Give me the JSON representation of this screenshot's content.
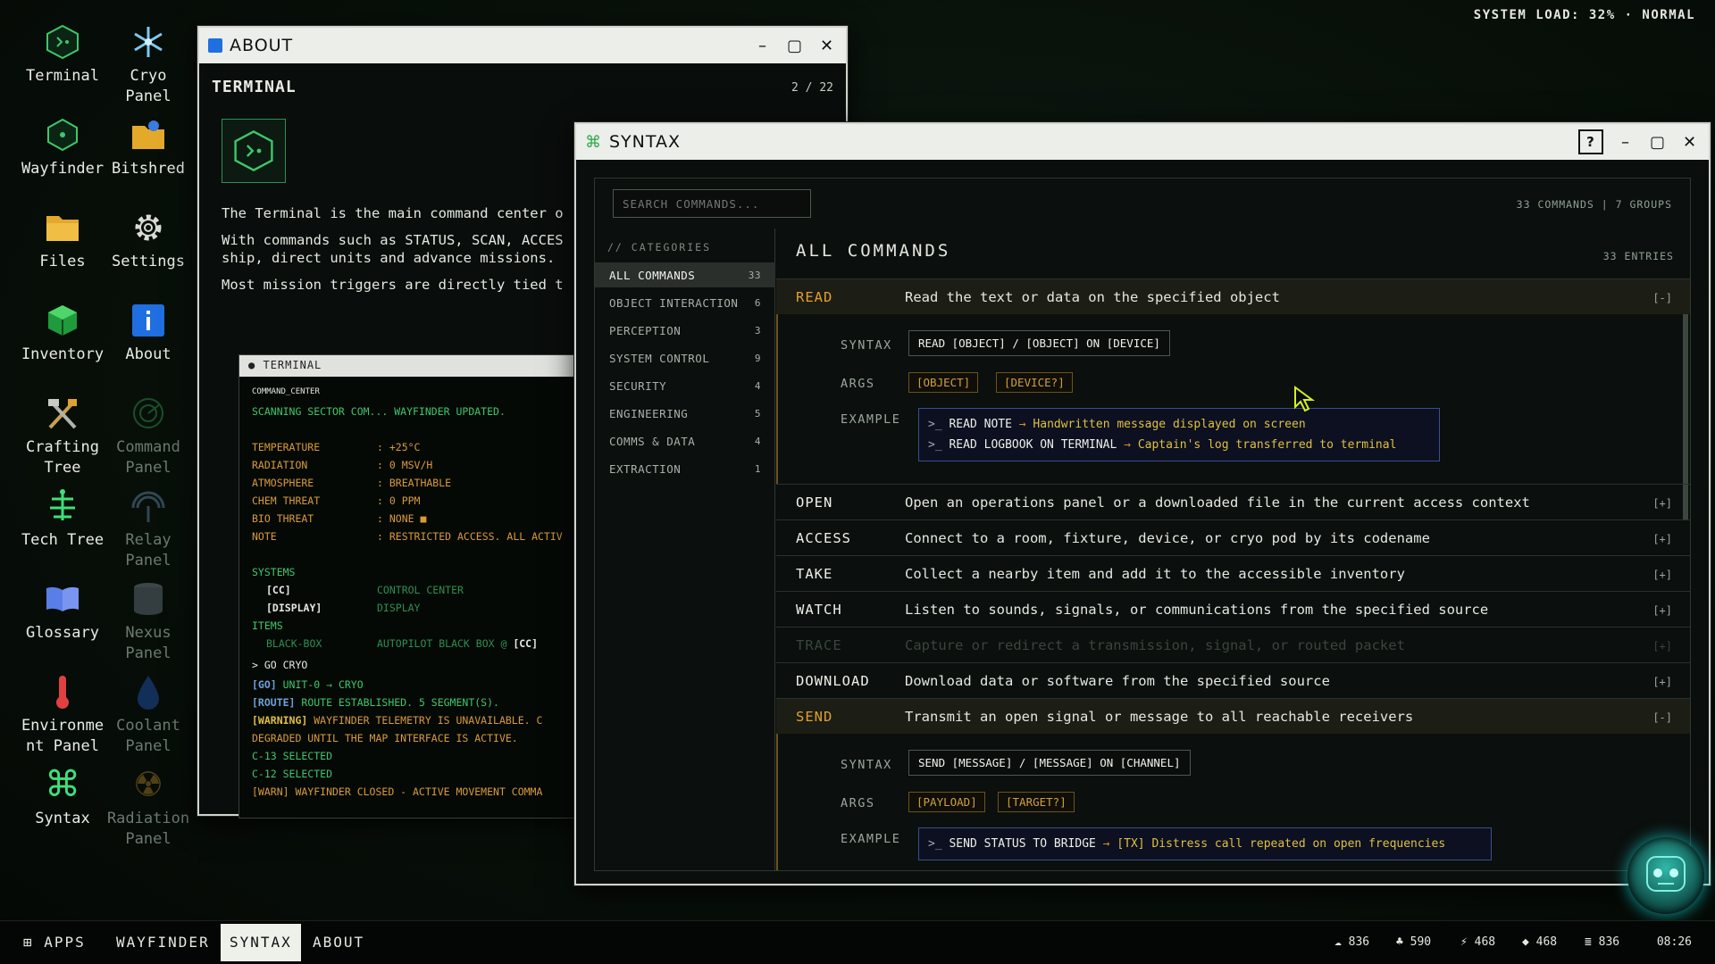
{
  "system": {
    "load": "SYSTEM LOAD: 32% · NORMAL"
  },
  "desktop": [
    {
      "label": "Terminal",
      "icon": "terminal-icon",
      "dim": false
    },
    {
      "label": "Cryo\nPanel",
      "icon": "snowflake-icon",
      "dim": false
    },
    {
      "label": "Wayfinder",
      "icon": "wayfinder-icon",
      "dim": false
    },
    {
      "label": "Bitshred",
      "icon": "bitshred-folder-icon",
      "dim": false
    },
    {
      "label": "Files",
      "icon": "folder-icon",
      "dim": false
    },
    {
      "label": "Settings",
      "icon": "gear-icon",
      "dim": false
    },
    {
      "label": "Inventory",
      "icon": "cube-icon",
      "dim": false
    },
    {
      "label": "About",
      "icon": "info-icon",
      "dim": false
    },
    {
      "label": "Crafting\nTree",
      "icon": "tools-icon",
      "dim": false
    },
    {
      "label": "Command\nPanel",
      "icon": "radar-icon",
      "dim": true
    },
    {
      "label": "Tech Tree",
      "icon": "tree-icon",
      "dim": false
    },
    {
      "label": "Relay\nPanel",
      "icon": "antenna-icon",
      "dim": true
    },
    {
      "label": "Glossary",
      "icon": "book-icon",
      "dim": false
    },
    {
      "label": "Nexus\nPanel",
      "icon": "database-icon",
      "dim": true
    },
    {
      "label": "Environme\nnt Panel",
      "icon": "thermometer-icon",
      "dim": false
    },
    {
      "label": "Coolant\nPanel",
      "icon": "droplet-icon",
      "dim": true
    },
    {
      "label": "Syntax",
      "icon": "command-key-icon",
      "dim": false
    },
    {
      "label": "Radiation\nPanel",
      "icon": "radiation-icon",
      "dim": true
    }
  ],
  "about": {
    "title": "ABOUT",
    "heading": "TERMINAL",
    "page": "2 / 22",
    "lines": [
      "The Terminal is the main command center o",
      "With commands such as STATUS, SCAN, ACCES",
      "ship, direct units and advance missions.",
      "Most mission triggers are directly tied t"
    ],
    "terminal": {
      "title": "TERMINAL",
      "sub": "COMMAND_CENTER",
      "scan": "SCANNING SECTOR COM... WAYFINDER UPDATED.",
      "readings": [
        {
          "k": "TEMPERATURE",
          "v": ": +25°C"
        },
        {
          "k": "RADIATION",
          "v": ": 0 MSV/H"
        },
        {
          "k": "ATMOSPHERE",
          "v": ": BREATHABLE"
        },
        {
          "k": "CHEM THREAT",
          "v": ": 0 PPM"
        },
        {
          "k": "BIO THREAT",
          "v": ": NONE ■"
        },
        {
          "k": "NOTE",
          "v": ": RESTRICTED ACCESS. ALL ACTIV"
        }
      ],
      "systems_h": "SYSTEMS",
      "systems": [
        {
          "k": "[CC]",
          "v": "CONTROL CENTER"
        },
        {
          "k": "[DISPLAY]",
          "v": "DISPLAY"
        }
      ],
      "items_h": "ITEMS",
      "item": {
        "k": "BLACK-BOX",
        "v": "AUTOPILOT BLACK BOX @ ",
        "tag": "[CC]"
      },
      "cmd": "> GO CRYO",
      "go_tag": "[GO]",
      "go": " UNIT-0 → CRYO",
      "route_tag": "[ROUTE]",
      "route": " ROUTE ESTABLISHED. 5 SEGMENT(S).",
      "warn_tag": "[WARNING]",
      "warn": " WAYFINDER TELEMETRY IS UNAVAILABLE. C",
      "warn2": "DEGRADED UNTIL THE MAP INTERFACE IS ACTIVE.",
      "sel1": "C-13 SELECTED",
      "sel2": "C-12 SELECTED",
      "last": "[WARN] WAYFINDER CLOSED - ACTIVE MOVEMENT COMMA"
    }
  },
  "syntax": {
    "title": "SYNTAX",
    "help": "?",
    "search_placeholder": "SEARCH COMMANDS...",
    "count": "33 COMMANDS | 7 GROUPS",
    "categories_h": "// CATEGORIES",
    "categories": [
      {
        "label": "ALL COMMANDS",
        "n": "33"
      },
      {
        "label": "OBJECT INTERACTION",
        "n": "6"
      },
      {
        "label": "PERCEPTION",
        "n": "3"
      },
      {
        "label": "SYSTEM CONTROL",
        "n": "9"
      },
      {
        "label": "SECURITY",
        "n": "4"
      },
      {
        "label": "ENGINEERING",
        "n": "5"
      },
      {
        "label": "COMMS & DATA",
        "n": "4"
      },
      {
        "label": "EXTRACTION",
        "n": "1"
      }
    ],
    "main_h": "ALL COMMANDS",
    "entries": "33 ENTRIES",
    "labels": {
      "syntax": "SYNTAX",
      "args": "ARGS",
      "example": "EXAMPLE"
    },
    "commands": [
      {
        "name": "READ",
        "desc": "Read the text or data on the specified object",
        "toggle": "[-]",
        "syntax": "READ [OBJECT] / [OBJECT] ON [DEVICE]",
        "args": [
          "[OBJECT]",
          "[DEVICE?]"
        ],
        "examples": [
          {
            "p": ">_",
            "c": " READ NOTE",
            "a": " → ",
            "r": "Handwritten message displayed on screen"
          },
          {
            "p": ">_",
            "c": " READ LOGBOOK ON TERMINAL",
            "a": " → ",
            "r": "Captain's log transferred to terminal"
          }
        ]
      },
      {
        "name": "OPEN",
        "desc": "Open an operations panel or a downloaded file in the current access context",
        "toggle": "[+]"
      },
      {
        "name": "ACCESS",
        "desc": "Connect to a room, fixture, device, or cryo pod by its codename",
        "toggle": "[+]"
      },
      {
        "name": "TAKE",
        "desc": "Collect a nearby item and add it to the accessible inventory",
        "toggle": "[+]"
      },
      {
        "name": "WATCH",
        "desc": "Listen to sounds, signals, or communications from the specified source",
        "toggle": "[+]"
      },
      {
        "name": "TRACE",
        "desc": "Capture or redirect a transmission, signal, or routed packet",
        "toggle": "[+]"
      },
      {
        "name": "DOWNLOAD",
        "desc": "Download data or software from the specified source",
        "toggle": "[+]"
      },
      {
        "name": "SEND",
        "desc": "Transmit an open signal or message to all reachable receivers",
        "toggle": "[-]",
        "syntax": "SEND [MESSAGE] / [MESSAGE] ON [CHANNEL]",
        "args": [
          "[PAYLOAD]",
          "[TARGET?]"
        ],
        "examples": [
          {
            "p": ">_",
            "c": " SEND STATUS TO BRIDGE",
            "a": " → ",
            "r": "[TX] Distress call repeated on open frequencies"
          }
        ]
      }
    ]
  },
  "taskbar": {
    "apps": "⊞ APPS",
    "tabs": [
      "WAYFINDER",
      "SYNTAX",
      "ABOUT"
    ],
    "stats": [
      {
        "icon": "cloud-icon",
        "glyph": "☁",
        "v": "836"
      },
      {
        "icon": "plant-icon",
        "glyph": "♣",
        "v": "590"
      },
      {
        "icon": "bolt-icon",
        "glyph": "⚡",
        "v": "468"
      },
      {
        "icon": "gem-icon",
        "glyph": "◆",
        "v": "468"
      },
      {
        "icon": "stack-icon",
        "glyph": "≣",
        "v": "836"
      }
    ],
    "clock": "08:26"
  }
}
